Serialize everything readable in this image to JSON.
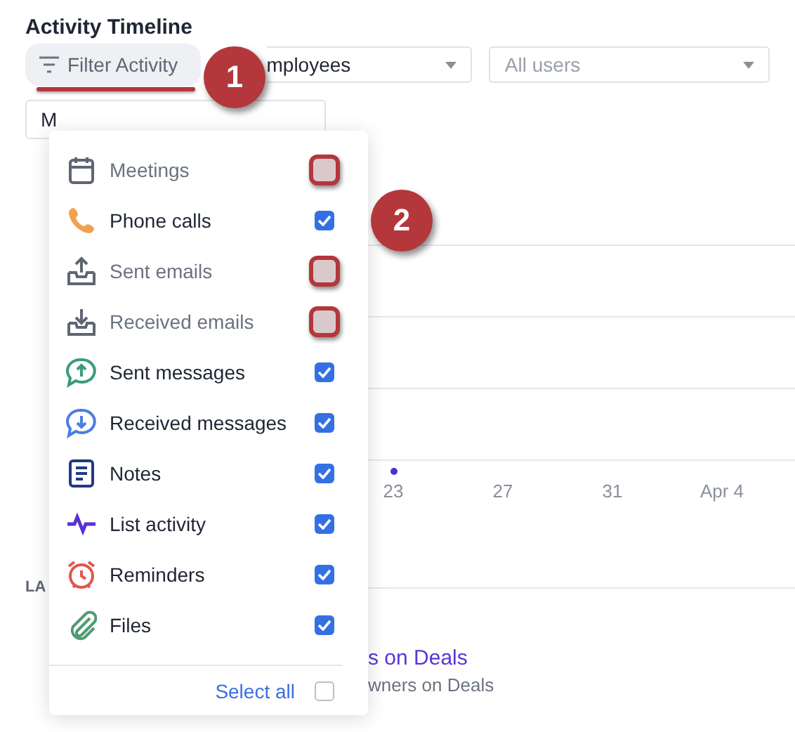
{
  "title": "Activity Timeline",
  "filter_button": {
    "label": "Filter Activity",
    "highlighted": true
  },
  "selects": [
    {
      "value": "mployees",
      "placeholder": false
    },
    {
      "value": "All users",
      "placeholder": true
    }
  ],
  "date_field": {
    "value": "M"
  },
  "menu": {
    "items": [
      {
        "label": "Meetings",
        "kind": "meeting",
        "checked": false,
        "highlighted": true
      },
      {
        "label": "Phone calls",
        "kind": "call",
        "checked": true,
        "highlighted": false
      },
      {
        "label": "Sent emails",
        "kind": "sent_email",
        "checked": false,
        "highlighted": true
      },
      {
        "label": "Received emails",
        "kind": "received_email",
        "checked": false,
        "highlighted": true
      },
      {
        "label": "Sent messages",
        "kind": "sent_message",
        "checked": true,
        "highlighted": false
      },
      {
        "label": "Received messages",
        "kind": "received_message",
        "checked": true,
        "highlighted": false
      },
      {
        "label": "Notes",
        "kind": "note",
        "checked": true,
        "highlighted": false
      },
      {
        "label": "List activity",
        "kind": "list_activity",
        "checked": true,
        "highlighted": false
      },
      {
        "label": "Reminders",
        "kind": "reminder",
        "checked": true,
        "highlighted": false
      },
      {
        "label": "Files",
        "kind": "file",
        "checked": true,
        "highlighted": false
      }
    ],
    "select_all": {
      "label": "Select all",
      "checked": false
    }
  },
  "chart": {
    "x_labels": [
      "23",
      "27",
      "31",
      "Apr 4"
    ]
  },
  "section_label": "LA",
  "link": "s on Deals",
  "subtitle": "wners on Deals",
  "callouts": [
    {
      "label": "1"
    },
    {
      "label": "2"
    }
  ]
}
